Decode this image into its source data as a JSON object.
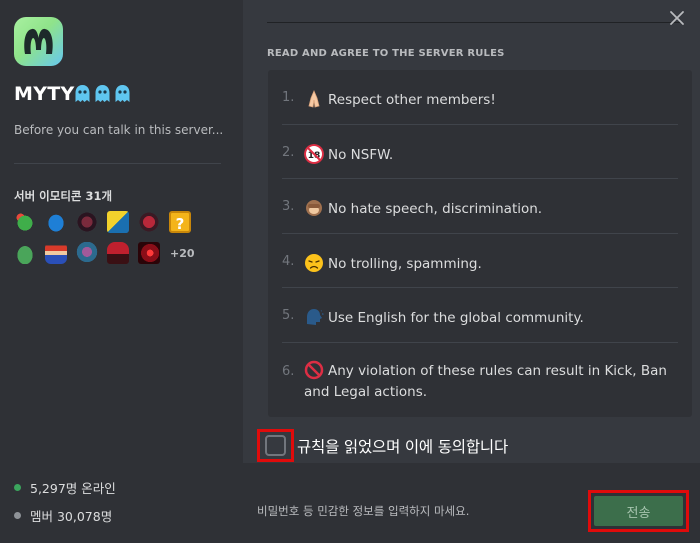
{
  "server": {
    "name": "MYTY",
    "intro": "Before you can talk in this server..."
  },
  "emoji": {
    "title": "서버 이모티콘 31개",
    "more": "+20",
    "row1": [
      "frog-emoji",
      "blue-ghost-emoji",
      "dark-face-emoji",
      "yellow-blue-face-emoji",
      "red-face-emoji",
      "question-block-emoji"
    ],
    "row2": [
      "green-frog-emoji",
      "mario-emoji",
      "blue-face-emoji",
      "red-hair-emoji",
      "red-glow-emoji"
    ]
  },
  "stats": {
    "online": "5,297명 온라인",
    "members": "멤버 30,078명"
  },
  "rules": {
    "heading": "READ AND AGREE TO THE SERVER RULES",
    "items": [
      {
        "num": "1.",
        "text": "Respect other members!",
        "icon": "folded-hands-icon"
      },
      {
        "num": "2.",
        "text": "No NSFW.",
        "icon": "no-under-18-icon"
      },
      {
        "num": "3.",
        "text": "No hate speech, discrimination.",
        "icon": "see-no-evil-monkey-icon"
      },
      {
        "num": "4.",
        "text": "No trolling, spamming.",
        "icon": "disappointed-face-icon"
      },
      {
        "num": "5.",
        "text": "Use English for the global community.",
        "icon": "speaking-head-icon"
      },
      {
        "num": "6.",
        "text": "Any violation of these rules can result in Kick, Ban and Legal actions.",
        "icon": "prohibited-icon"
      }
    ]
  },
  "agree": {
    "label": "규칙을 읽었으며 이에 동의합니다"
  },
  "footer": {
    "notice": "비밀번호 등 민감한 정보를 입력하지 마세요.",
    "submit_label": "전송"
  },
  "colors": {
    "accent_green": "#3c6e4b",
    "highlight_red": "#e00b0b",
    "online": "#3ba55d"
  }
}
